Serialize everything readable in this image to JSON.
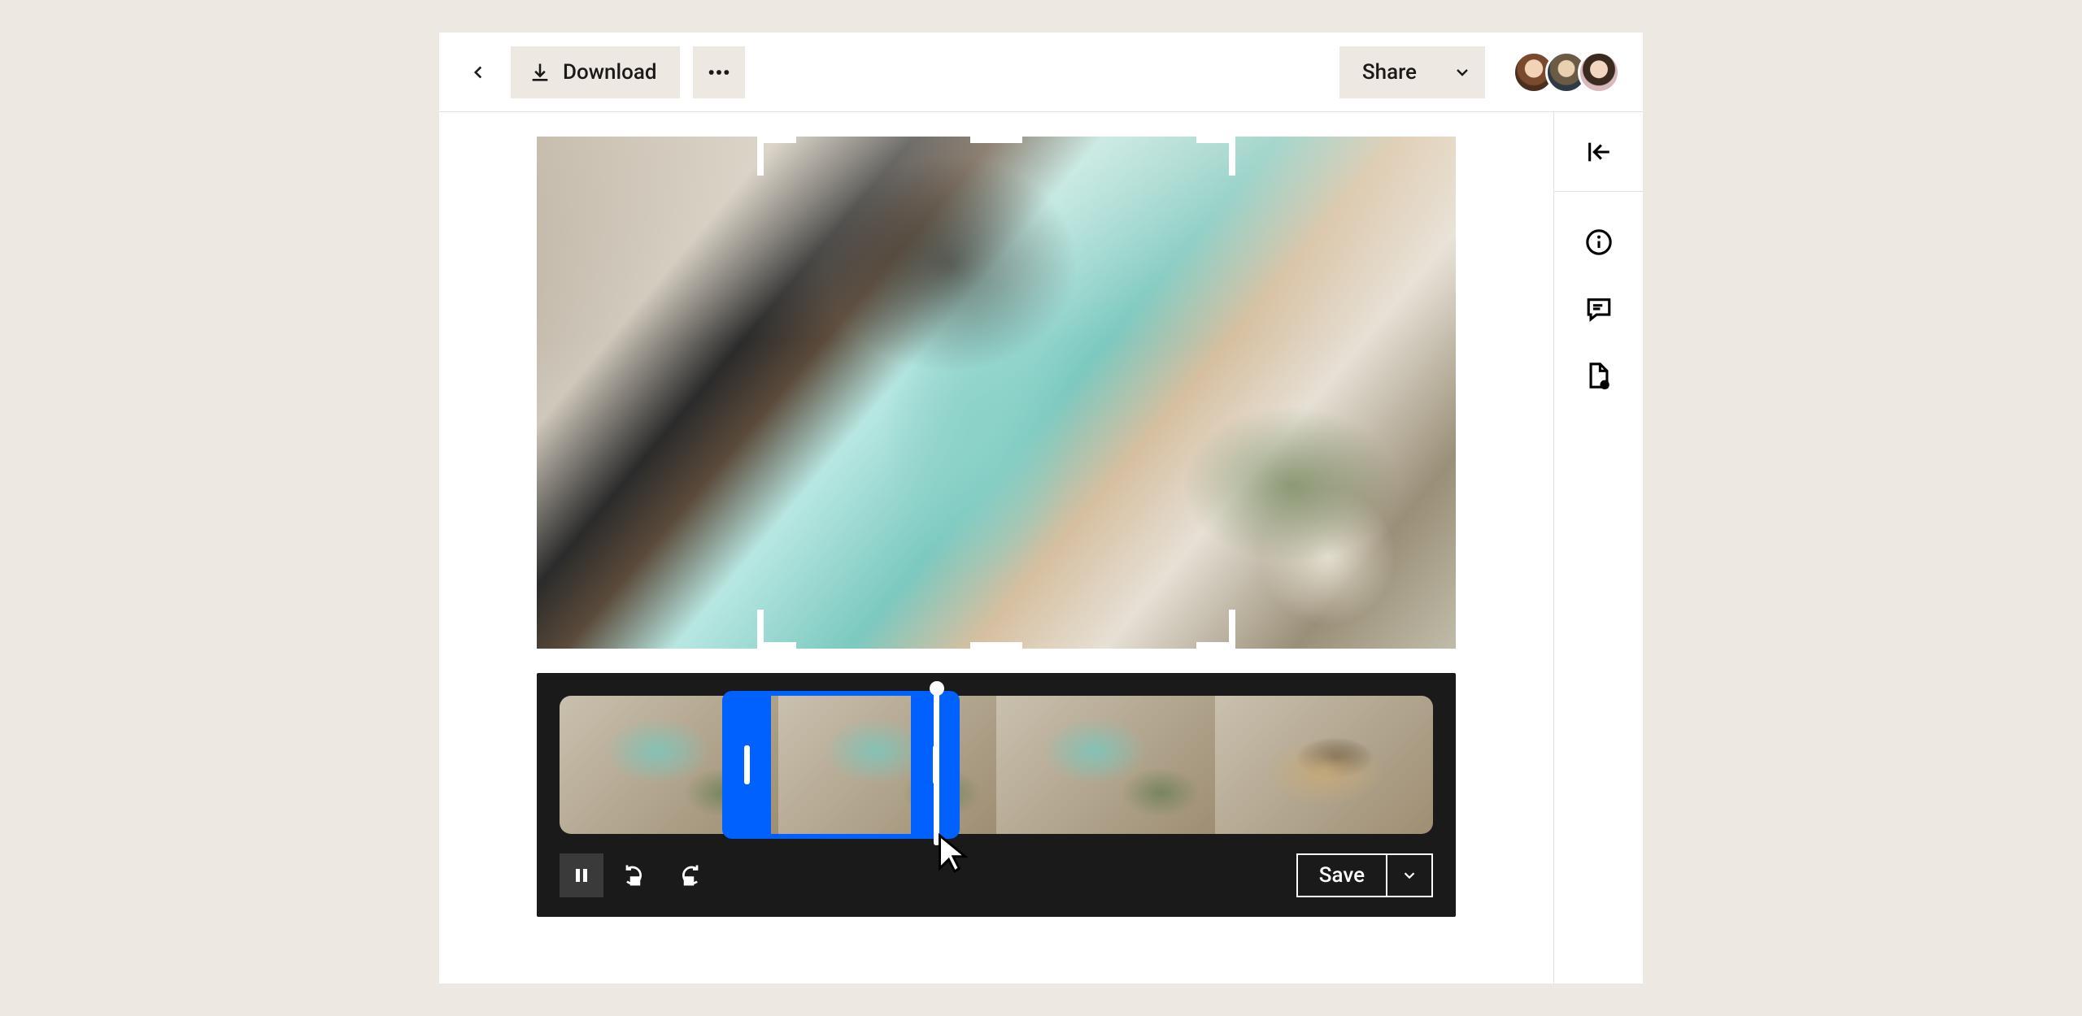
{
  "toolbar": {
    "download_label": "Download",
    "share_label": "Share"
  },
  "editor": {
    "save_label": "Save"
  },
  "icons": {
    "back": "back-icon",
    "download": "download-icon",
    "more": "more-horizontal-icon",
    "share_caret": "chevron-down-icon",
    "collapse": "collapse-panel-icon",
    "info": "info-icon",
    "comments": "comment-icon",
    "file_activity": "file-activity-icon",
    "pause": "pause-icon",
    "rotate_left": "rotate-left-icon",
    "rotate_right": "rotate-right-icon",
    "save_caret": "chevron-down-icon"
  },
  "collaborators": [
    {
      "name": "collaborator-1"
    },
    {
      "name": "collaborator-2"
    },
    {
      "name": "collaborator-3"
    }
  ],
  "timeline": {
    "thumbnails": 4,
    "trim_handles": [
      "left",
      "right"
    ]
  }
}
